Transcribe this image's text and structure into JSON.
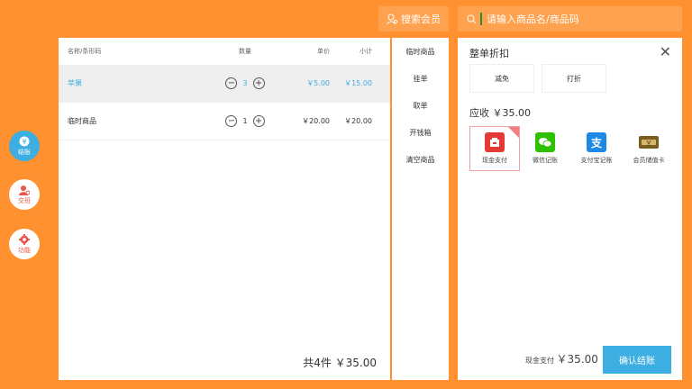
{
  "top": {
    "member_label": "搜索会员",
    "search_placeholder": "请输入商品名/商品码"
  },
  "nav": {
    "checkout": "结账",
    "shift": "交班",
    "functions": "功能"
  },
  "cart": {
    "headers": {
      "name": "名称/条形码",
      "qty": "数量",
      "price": "单价",
      "subtotal": "小计"
    },
    "rows": [
      {
        "name": "苹果",
        "qty": "3",
        "price": "￥5.00",
        "subtotal": "￥15.00"
      },
      {
        "name": "临时商品",
        "qty": "1",
        "price": "￥20.00",
        "subtotal": "￥20.00"
      }
    ],
    "total": "共4件  ￥35.00"
  },
  "side_actions": [
    "临时商品",
    "挂单",
    "取单",
    "开钱箱",
    "清空商品"
  ],
  "payment": {
    "title": "整单折扣",
    "discounts": [
      "减免",
      "打折"
    ],
    "due": "应收 ￥35.00",
    "methods": [
      {
        "label": "现金支付",
        "icon": "cash-icon",
        "color": "#E53935"
      },
      {
        "label": "微信记账",
        "icon": "wechat-icon",
        "color": "#2DC100"
      },
      {
        "label": "支付宝记账",
        "icon": "alipay-icon",
        "color": "#1E88E5"
      },
      {
        "label": "会员储值卡",
        "icon": "member-card-icon",
        "color": "#7A5C21"
      }
    ],
    "selected_method": "现金支付",
    "amount": "￥35.00",
    "confirm": "确认结账"
  }
}
